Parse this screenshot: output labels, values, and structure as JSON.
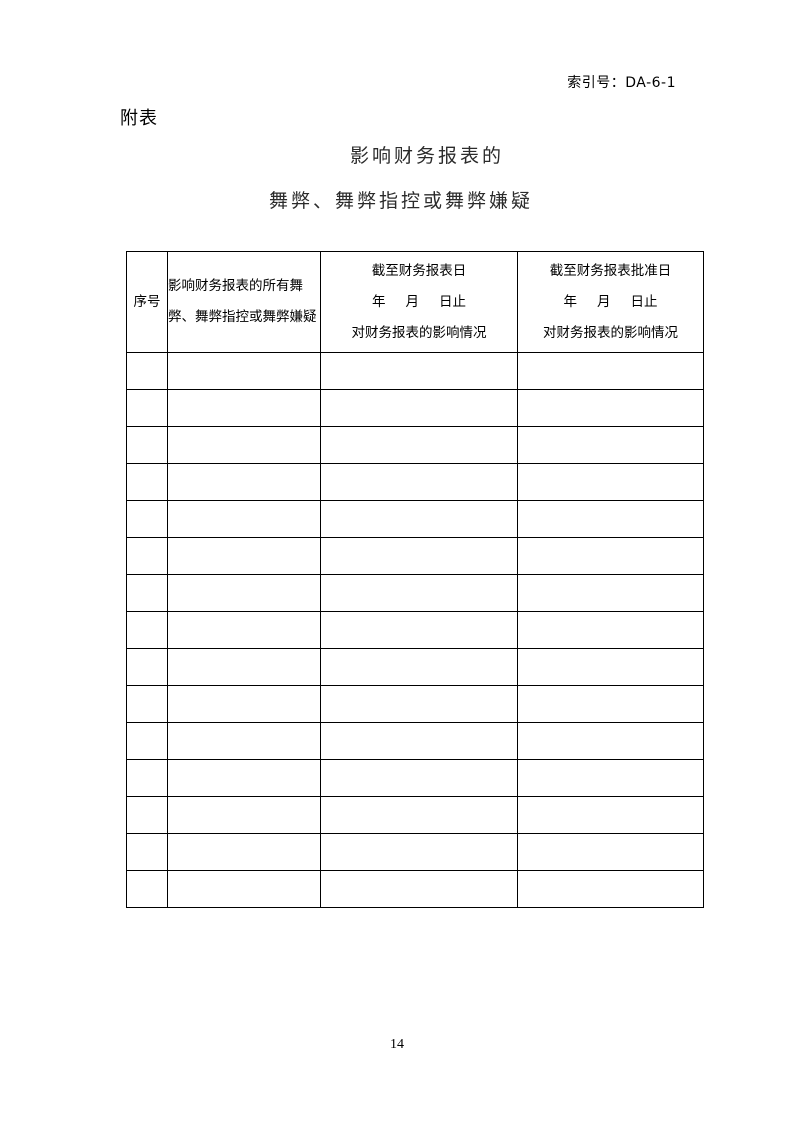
{
  "document": {
    "index_number": "索引号：DA-6-1",
    "attachment_label": "附表",
    "title_line_1": "影响财务报表的",
    "title_line_2": "舞弊、舞弊指控或舞弊嫌疑",
    "page_number": "14"
  },
  "table": {
    "headers": {
      "seq": "序号",
      "description": "影响财务报表的所有舞弊、舞弊指控或舞弊嫌疑",
      "as_of_statement_date": {
        "line_1": "截至财务报表日",
        "line_2_year": "年",
        "line_2_month": "月",
        "line_2_day": "日止",
        "line_3": "对财务报表的影响情况"
      },
      "as_of_approval_date": {
        "line_1": "截至财务报表批准日",
        "line_2_year": "年",
        "line_2_month": "月",
        "line_2_day": "日止",
        "line_3": "对财务报表的影响情况"
      }
    },
    "row_count": 15,
    "rows": [
      {
        "seq": "",
        "description": "",
        "as_of_statement_date": "",
        "as_of_approval_date": ""
      },
      {
        "seq": "",
        "description": "",
        "as_of_statement_date": "",
        "as_of_approval_date": ""
      },
      {
        "seq": "",
        "description": "",
        "as_of_statement_date": "",
        "as_of_approval_date": ""
      },
      {
        "seq": "",
        "description": "",
        "as_of_statement_date": "",
        "as_of_approval_date": ""
      },
      {
        "seq": "",
        "description": "",
        "as_of_statement_date": "",
        "as_of_approval_date": ""
      },
      {
        "seq": "",
        "description": "",
        "as_of_statement_date": "",
        "as_of_approval_date": ""
      },
      {
        "seq": "",
        "description": "",
        "as_of_statement_date": "",
        "as_of_approval_date": ""
      },
      {
        "seq": "",
        "description": "",
        "as_of_statement_date": "",
        "as_of_approval_date": ""
      },
      {
        "seq": "",
        "description": "",
        "as_of_statement_date": "",
        "as_of_approval_date": ""
      },
      {
        "seq": "",
        "description": "",
        "as_of_statement_date": "",
        "as_of_approval_date": ""
      },
      {
        "seq": "",
        "description": "",
        "as_of_statement_date": "",
        "as_of_approval_date": ""
      },
      {
        "seq": "",
        "description": "",
        "as_of_statement_date": "",
        "as_of_approval_date": ""
      },
      {
        "seq": "",
        "description": "",
        "as_of_statement_date": "",
        "as_of_approval_date": ""
      },
      {
        "seq": "",
        "description": "",
        "as_of_statement_date": "",
        "as_of_approval_date": ""
      },
      {
        "seq": "",
        "description": "",
        "as_of_statement_date": "",
        "as_of_approval_date": ""
      }
    ]
  }
}
